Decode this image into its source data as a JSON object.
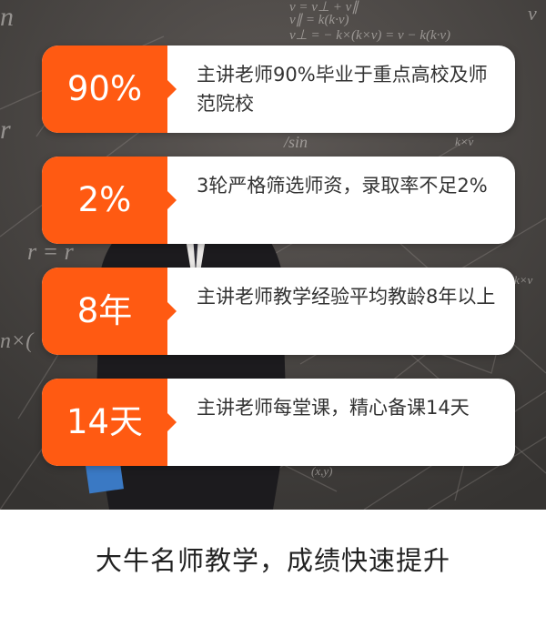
{
  "hero": {
    "chalk_texts": [
      "v = v⊥ + v∥",
      "v∥ = k(k·v)",
      "v⊥ = − k×(k×v) = v − k(k·v)",
      "/sin",
      "k×v",
      "r = r",
      "n×(",
      "k×v",
      "(x,y)",
      "r",
      "n",
      "v"
    ]
  },
  "cards": [
    {
      "stat": "90%",
      "text": "主讲老师90%毕业于重点高校及师范院校"
    },
    {
      "stat": "2%",
      "text": "3轮严格筛选师资，录取率不足2%"
    },
    {
      "stat": "8年",
      "text": "主讲老师教学经验平均教龄8年以上"
    },
    {
      "stat": "14天",
      "text": "主讲老师每堂课，精心备课14天"
    }
  ],
  "caption": "大牛名师教学，成绩快速提升",
  "colors": {
    "accent": "#ff5a12",
    "card_bg": "#ffffff",
    "chalkboard": "#4b4846",
    "body_text": "#333333",
    "caption_text": "#222222"
  },
  "icons": {
    "card_pointer": "right-triangle-pointer"
  }
}
